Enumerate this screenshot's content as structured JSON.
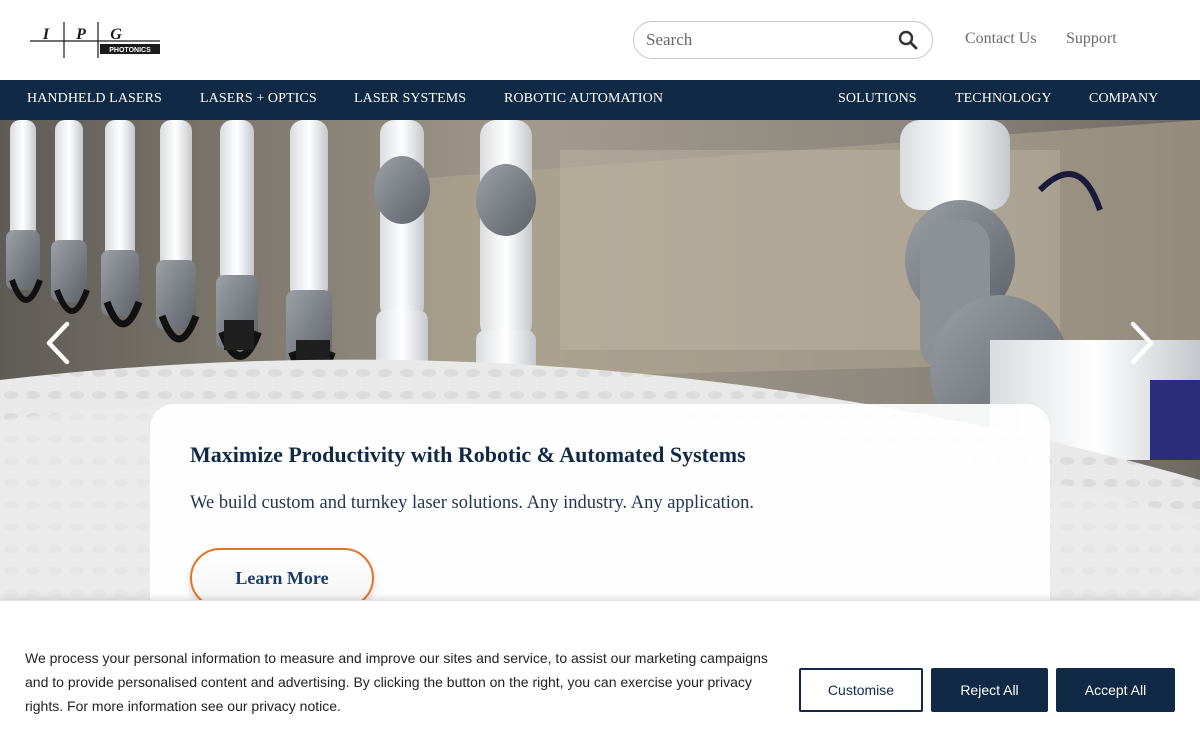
{
  "header": {
    "logo": {
      "icon": "ipg-photonics-logo",
      "letters": [
        "I",
        "P",
        "G"
      ],
      "subtext": "PHOTONICS"
    },
    "search": {
      "placeholder": "Search",
      "value": "",
      "icon": "search-icon"
    },
    "links": {
      "contact": "Contact Us",
      "support": "Support"
    }
  },
  "nav": {
    "left": [
      "HANDHELD LASERS",
      "LASERS + OPTICS",
      "LASER SYSTEMS",
      "ROBOTIC AUTOMATION"
    ],
    "right": [
      "SOLUTIONS",
      "TECHNOLOGY",
      "COMPANY"
    ]
  },
  "hero": {
    "image": "robotic-arms-production-line",
    "prev_icon": "chevron-left-icon",
    "next_icon": "chevron-right-icon",
    "title": "Maximize Productivity with Robotic & Automated Systems",
    "subtitle": "We build custom and turnkey laser solutions. Any industry. Any application.",
    "cta": "Learn More"
  },
  "cookie": {
    "text": "We process your personal information to measure and improve our sites and service, to assist our marketing campaigns and to provide personalised content and advertising. By clicking the button on the right, you can exercise your privacy rights. For more information see our privacy notice.",
    "buttons": {
      "customise": "Customise",
      "reject": "Reject All",
      "accept": "Accept All"
    }
  },
  "colors": {
    "brand_navy": "#102a45",
    "accent_orange": "#e0742a",
    "link_gray": "#6b6b6b"
  }
}
